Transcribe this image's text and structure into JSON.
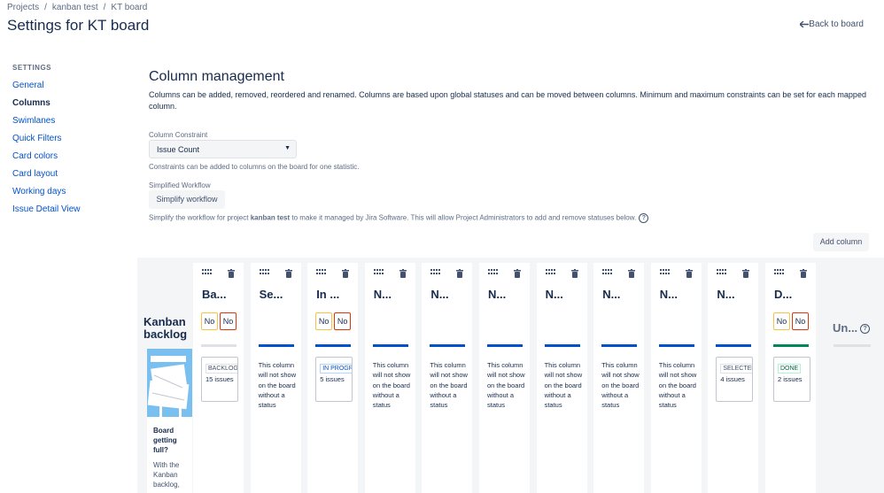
{
  "breadcrumbs": [
    "Projects",
    "kanban test",
    "KT board"
  ],
  "page_title": "Settings for KT board",
  "back_link": "Back to board",
  "sidebar": {
    "heading": "SETTINGS",
    "items": [
      {
        "label": "General"
      },
      {
        "label": "Columns",
        "active": true
      },
      {
        "label": "Swimlanes"
      },
      {
        "label": "Quick Filters"
      },
      {
        "label": "Card colors"
      },
      {
        "label": "Card layout"
      },
      {
        "label": "Working days"
      },
      {
        "label": "Issue Detail View"
      }
    ]
  },
  "main": {
    "heading": "Column management",
    "description": "Columns can be added, removed, reordered and renamed. Columns are based upon global statuses and can be moved between columns. Minimum and maximum constraints can be set for each mapped column.",
    "constraint_label": "Column Constraint",
    "constraint_value": "Issue Count",
    "constraint_help": "Constraints can be added to columns on the board for one statistic.",
    "workflow_label": "Simplified Workflow",
    "workflow_button": "Simplify workflow",
    "workflow_help_pre": "Simplify the workflow for project ",
    "workflow_help_project": "kanban test",
    "workflow_help_post": " to make it managed by Jira Software. This will allow Project Administrators to add and remove statuses below.",
    "add_column": "Add column"
  },
  "kanban_backlog": {
    "title_line1": "Kanban",
    "title_line2": "backlog",
    "card_title": "Board getting full?",
    "card_body": "With the Kanban backlog,"
  },
  "no_status_text": "This column will not show on the board without a status",
  "columns": [
    {
      "name": "Ba...",
      "min": "No",
      "max": "No",
      "bar": "grey",
      "status": "BACKLOG",
      "count": "15 issues"
    },
    {
      "name": "Se...",
      "bar": "blue"
    },
    {
      "name": "In ...",
      "min": "No",
      "max": "No",
      "bar": "blue",
      "status": "IN PROGRESS",
      "count": "5 issues"
    },
    {
      "name": "N...",
      "bar": "blue"
    },
    {
      "name": "N...",
      "bar": "blue"
    },
    {
      "name": "N...",
      "bar": "blue"
    },
    {
      "name": "N...",
      "bar": "blue"
    },
    {
      "name": "N...",
      "bar": "blue"
    },
    {
      "name": "N...",
      "bar": "blue"
    },
    {
      "name": "N...",
      "bar": "blue",
      "status": "SELECTED",
      "count": "4 issues"
    },
    {
      "name": "D...",
      "min": "No",
      "max": "No",
      "bar": "green",
      "status": "DONE",
      "count": "2 issues"
    }
  ],
  "unmapped": "Un...",
  "colors": {
    "link": "#0052cc",
    "text": "#172b4d",
    "done": "#00875a",
    "grey_bg": "#f4f5f7"
  }
}
